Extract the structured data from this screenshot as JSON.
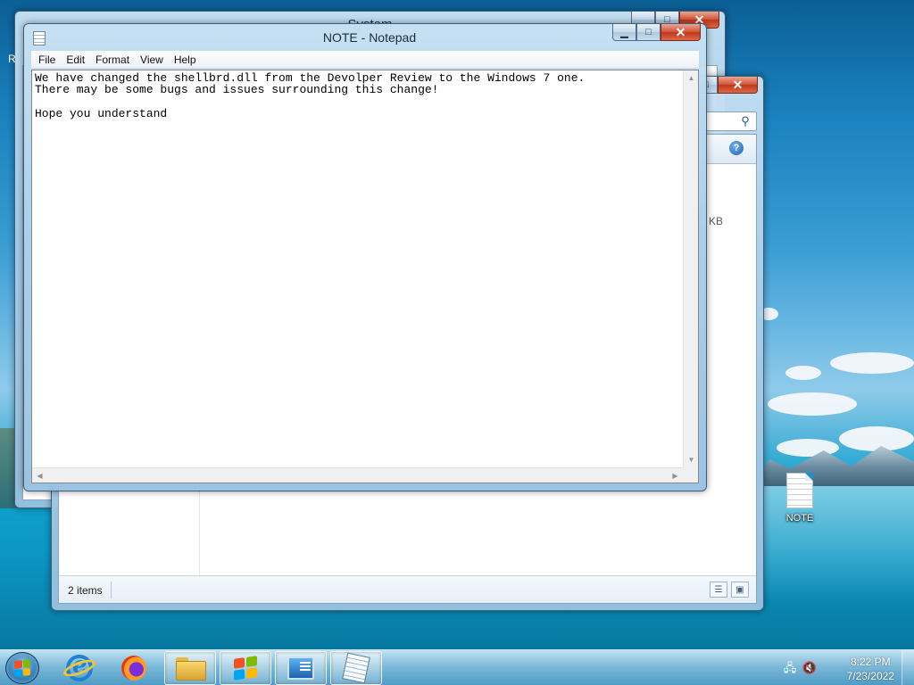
{
  "system_window": {
    "title": "System",
    "edge_letter": "R"
  },
  "explorer_window": {
    "size_text": "KB",
    "status_text": "2 items"
  },
  "notepad": {
    "title": "NOTE - Notepad",
    "menu": [
      "File",
      "Edit",
      "Format",
      "View",
      "Help"
    ],
    "content": "We have changed the shellbrd.dll from the Devolper Review to the Windows 7 one.\nThere may be some bugs and issues surrounding this change!\n\nHope you understand"
  },
  "desktop": {
    "icons": [
      {
        "label": "NOTE",
        "icon": "text-document-icon"
      }
    ]
  },
  "taskbar": {
    "apps": [
      {
        "name": "internet-explorer",
        "icon": "internet-explorer-icon"
      },
      {
        "name": "firefox",
        "icon": "firefox-icon"
      },
      {
        "name": "windows-explorer",
        "icon": "folder-icon"
      },
      {
        "name": "windows-logo",
        "icon": "windows-logo-icon"
      },
      {
        "name": "system-properties",
        "icon": "system-properties-icon"
      },
      {
        "name": "notepad",
        "icon": "notepad-icon"
      }
    ],
    "clock_time": "8:22 PM",
    "clock_date": "7/23/2022"
  },
  "colors": {
    "close_button": "#c2361a",
    "taskbar": "#4696c3",
    "desktop_sky": "#1a82bf"
  }
}
